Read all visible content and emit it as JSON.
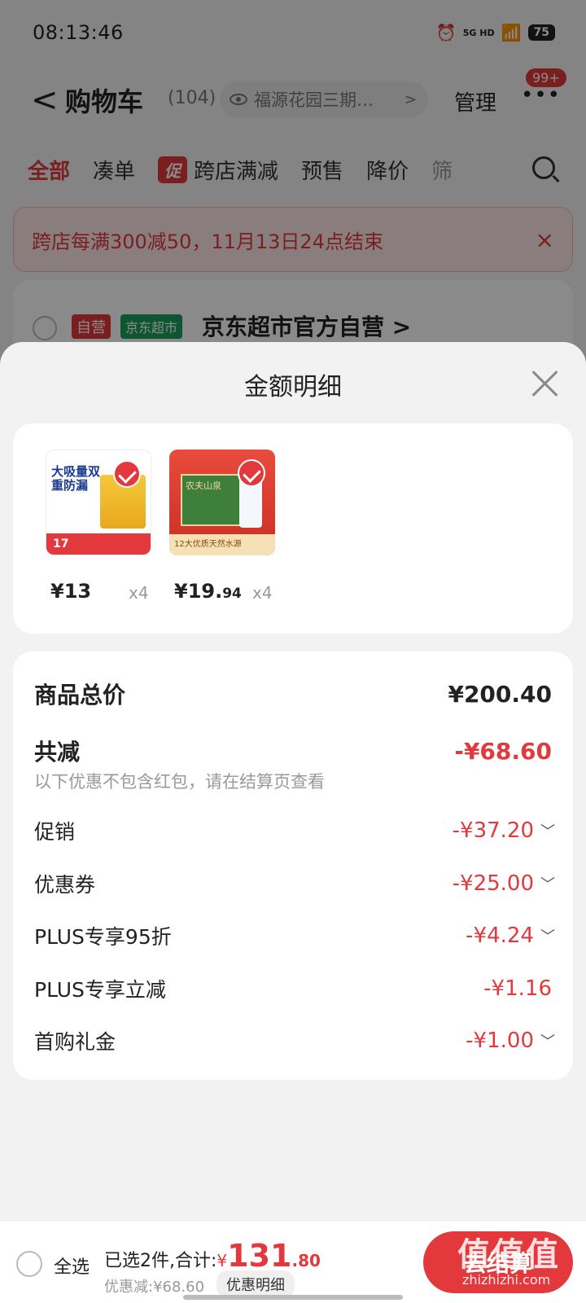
{
  "status_bar": {
    "time": "08:13:46",
    "network": "5G HD",
    "battery": "75"
  },
  "header": {
    "back": "<",
    "title": "购物车",
    "count": "(104)",
    "location": "福源花园三期…",
    "location_chevron": ">",
    "manage": "管理",
    "more": "•••",
    "more_badge": "99+"
  },
  "tabs": {
    "all": "全部",
    "combine": "凑单",
    "promo_tag": "促",
    "cross_store": "跨店满减",
    "presale": "预售",
    "price_drop": "降价",
    "filter": "筛"
  },
  "banner": {
    "text": "跨店每满300减50，11月13日24点结束",
    "close": "×"
  },
  "store": {
    "tag_self": "自营",
    "tag_market": "京东超市",
    "name": "京东超市官方自营",
    "chevron": ">"
  },
  "sheet": {
    "title": "金额明细",
    "products": [
      {
        "image_text": "大吸量双重防漏",
        "strip_text": "17",
        "price_main": "¥13",
        "price_dec": "",
        "qty": "x4"
      },
      {
        "image_text": "农夫山泉",
        "strip_text": "12大优质天然水源",
        "price_main": "¥19.",
        "price_dec": "94",
        "qty": "x4"
      }
    ],
    "total_label": "商品总价",
    "total_value": "¥200.40",
    "reduce_label": "共减",
    "reduce_value": "-¥68.60",
    "reduce_note": "以下优惠不包含红包，请在结算页查看",
    "items": [
      {
        "label": "促销",
        "value": "-¥37.20",
        "arrow": "﹀"
      },
      {
        "label": "优惠券",
        "value": "-¥25.00",
        "arrow": "﹀"
      },
      {
        "label": "PLUS专享95折",
        "value": "-¥4.24",
        "arrow": "﹀"
      },
      {
        "label": "PLUS专享立减",
        "value": "-¥1.16",
        "arrow": ""
      },
      {
        "label": "首购礼金",
        "value": "-¥1.00",
        "arrow": "﹀"
      }
    ]
  },
  "bottom_bar": {
    "select_all": "全选",
    "selected_text": "已选2件,合计:",
    "yen": "¥",
    "amount_int": "131",
    "amount_dec": ".80",
    "discount_text": "优惠减:¥68.60",
    "discount_detail_button": "优惠明细",
    "checkout": "去结算"
  },
  "watermark": {
    "main": "值值值",
    "sub": "zhizhizhi.com"
  },
  "colors": {
    "accent": "#e4393c",
    "market_green": "#1aa05c",
    "overlay": "rgba(0,0,0,0.46)"
  }
}
